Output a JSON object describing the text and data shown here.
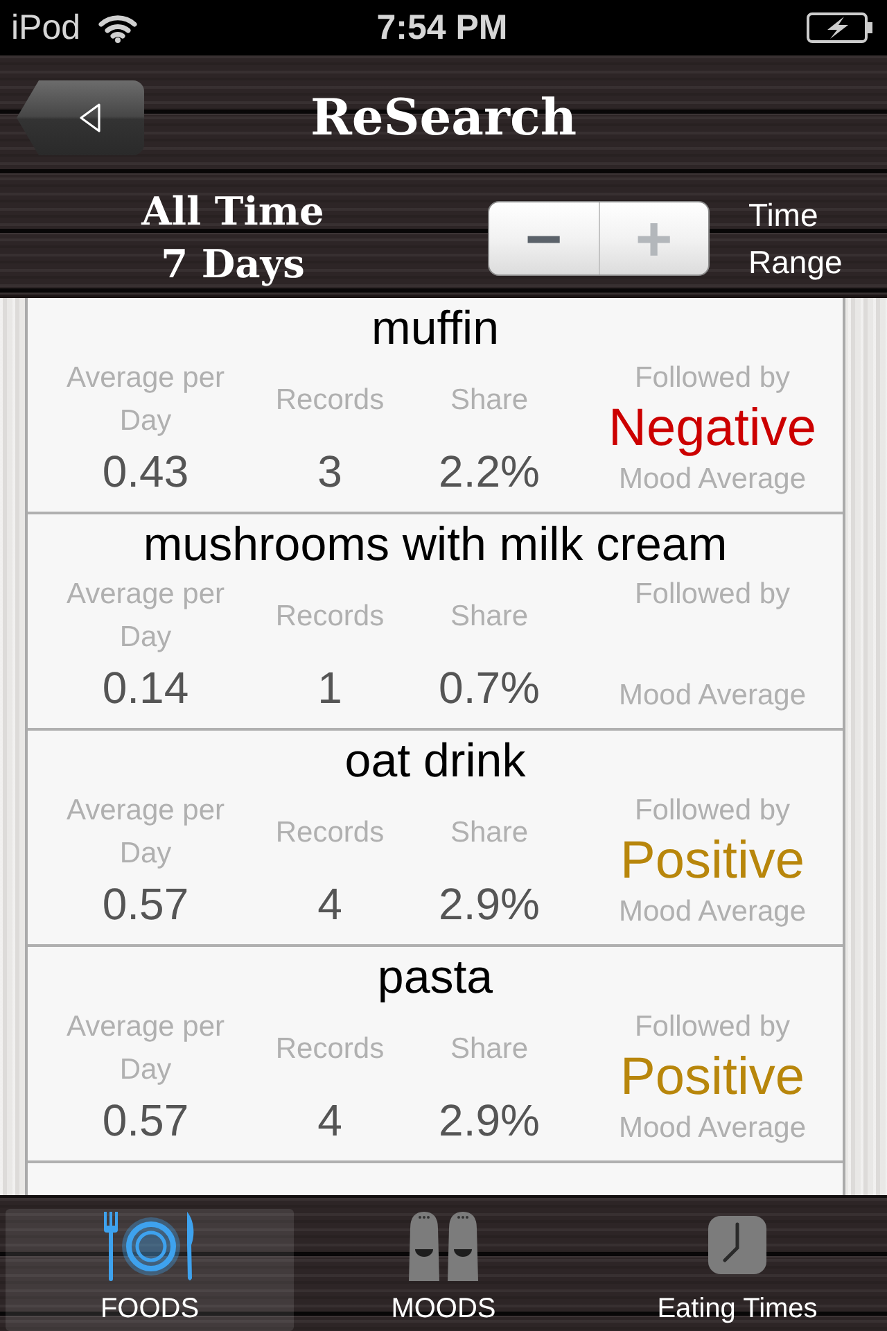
{
  "status_bar": {
    "carrier": "iPod",
    "time": "7:54 PM"
  },
  "nav_bar": {
    "title": "ReSearch"
  },
  "range_bar": {
    "labels": [
      "All Time",
      "7 Days"
    ],
    "stepper": [
      {
        "symbol": "−",
        "disabled": false
      },
      {
        "symbol": "+",
        "disabled": true
      }
    ],
    "caption": "Time Range"
  },
  "rows": [
    {
      "name": "muffin",
      "stats": [
        {
          "label": "Average per Day",
          "value": "0.43"
        },
        {
          "label": "Records",
          "value": "3"
        },
        {
          "label": "Share",
          "value": "2.2%"
        }
      ],
      "mood": {
        "caption": "Followed by",
        "value": "Negative",
        "color": "#cc0000",
        "footer": "Mood Average"
      }
    },
    {
      "name": "mushrooms with milk cream",
      "stats": [
        {
          "label": "Average per Day",
          "value": "0.14"
        },
        {
          "label": "Records",
          "value": "1"
        },
        {
          "label": "Share",
          "value": "0.7%"
        }
      ],
      "mood": {
        "caption": "Followed by",
        "footer": "Mood Average"
      }
    },
    {
      "name": "oat drink",
      "stats": [
        {
          "label": "Average per Day",
          "value": "0.57"
        },
        {
          "label": "Records",
          "value": "4"
        },
        {
          "label": "Share",
          "value": "2.9%"
        }
      ],
      "mood": {
        "caption": "Followed by",
        "value": "Positive",
        "color": "#b8860b",
        "footer": "Mood Average"
      }
    },
    {
      "name": "pasta",
      "stats": [
        {
          "label": "Average per Day",
          "value": "0.57"
        },
        {
          "label": "Records",
          "value": "4"
        },
        {
          "label": "Share",
          "value": "2.9%"
        }
      ],
      "mood": {
        "caption": "Followed by",
        "value": "Positive",
        "color": "#b8860b",
        "footer": "Mood Average"
      }
    }
  ],
  "tabs": [
    {
      "label": "FOODS",
      "selected": true
    },
    {
      "label": "MOODS",
      "selected": false
    },
    {
      "label": "Eating Times",
      "selected": false
    }
  ]
}
